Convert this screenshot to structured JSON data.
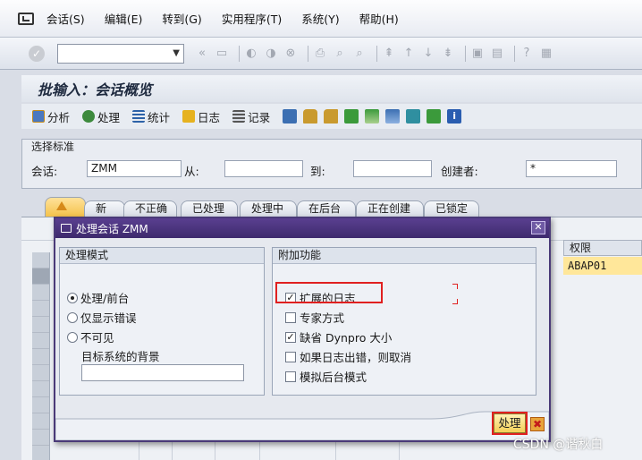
{
  "menu": {
    "items": [
      "会话(S)",
      "编辑(E)",
      "转到(G)",
      "实用程序(T)",
      "系统(Y)",
      "帮助(H)"
    ]
  },
  "std_toolbar": {
    "command_field_value": "",
    "dropdown_arrow": "▼"
  },
  "title": "批输入：会话概览",
  "app_toolbar": {
    "analyze": "分析",
    "process": "处理",
    "statistics": "统计",
    "log": "日志",
    "record": "记录"
  },
  "selection": {
    "header": "选择标准",
    "session_label": "会话:",
    "session_value": "ZMM",
    "from_label": "从:",
    "from_value": "",
    "to_label": "到:",
    "to_value": "",
    "creator_label": "创建者:",
    "creator_value": "*"
  },
  "tabs": [
    "",
    "新",
    "不正确",
    "已处理",
    "处理中",
    "在后台",
    "正在创建",
    "已锁定"
  ],
  "table": {
    "header_right": "权限",
    "cell_right": "ABAP01"
  },
  "dialog": {
    "title": "处理会话 ZMM",
    "close": "✕",
    "mode_group": {
      "header": "处理模式",
      "options": [
        "处理/前台",
        "仅显示错误",
        "不可见"
      ],
      "selected_index": 0,
      "target_label": "目标系统的背景",
      "target_value": ""
    },
    "extra_group": {
      "header": "附加功能",
      "options": [
        {
          "label": "扩展的日志",
          "checked": true
        },
        {
          "label": "专家方式",
          "checked": false
        },
        {
          "label": "缺省 Dynpro 大小",
          "checked": true
        },
        {
          "label": "如果日志出错，则取消",
          "checked": false
        },
        {
          "label": "模拟后台模式",
          "checked": false
        }
      ]
    },
    "process_button": "处理",
    "cancel_button": "✖"
  },
  "watermark": "CSDN @谐秋白",
  "colors": {
    "dialog_title": "#4a3a78",
    "highlight": "#e02020",
    "active_tab": "#f4c24b"
  }
}
